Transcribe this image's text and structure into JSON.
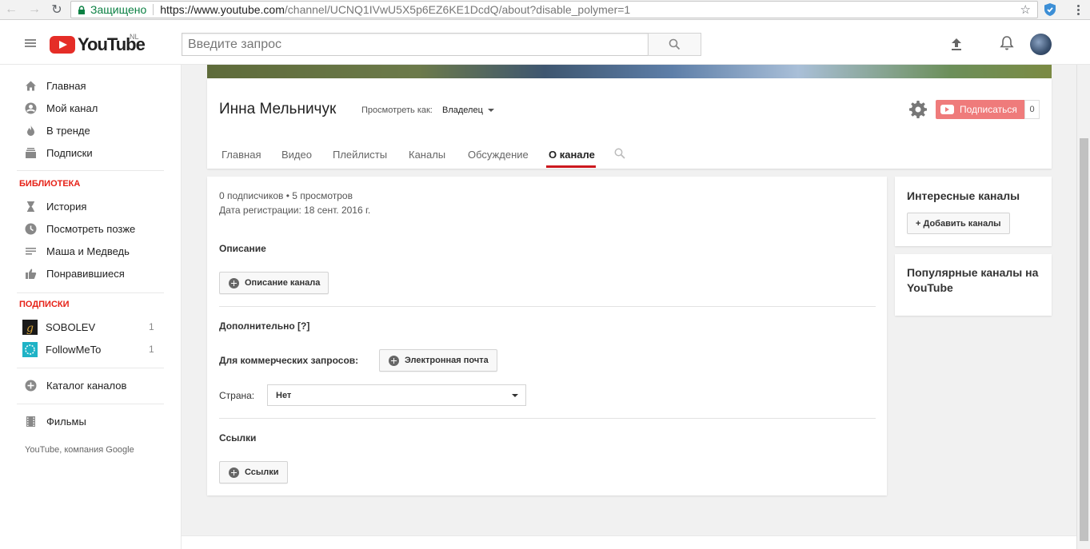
{
  "browser": {
    "secure_label": "Защищено",
    "url_host": "https://www.youtube.com",
    "url_path": "/channel/UCNQ1IVwU5X5p6EZ6KE1DcdQ/about?disable_polymer=1"
  },
  "header": {
    "logo_text": "YouTube",
    "logo_region": "NL",
    "search_placeholder": "Введите запрос"
  },
  "sidebar": {
    "main_items": [
      {
        "label": "Главная",
        "icon": "home-icon"
      },
      {
        "label": "Мой канал",
        "icon": "account-icon"
      },
      {
        "label": "В тренде",
        "icon": "trending-icon"
      },
      {
        "label": "Подписки",
        "icon": "subscriptions-icon"
      }
    ],
    "library_heading": "БИБЛИОТЕКА",
    "library_items": [
      {
        "label": "История",
        "icon": "history-icon"
      },
      {
        "label": "Посмотреть позже",
        "icon": "watch-later-icon"
      },
      {
        "label": "Маша и Медведь",
        "icon": "playlist-icon"
      },
      {
        "label": "Понравившиеся",
        "icon": "thumbs-up-icon"
      }
    ],
    "subscriptions_heading": "ПОДПИСКИ",
    "subscriptions": [
      {
        "label": "SOBOLEV",
        "count": "1"
      },
      {
        "label": "FollowMeTo",
        "count": "1"
      }
    ],
    "catalog_label": "Каталог каналов",
    "movies_label": "Фильмы",
    "footer": "YouTube, компания Google"
  },
  "channel": {
    "name": "Инна Мельничук",
    "view_as_label": "Просмотреть как:",
    "view_as_value": "Владелец",
    "subscribe_label": "Подписаться",
    "subscriber_count": "0",
    "tabs": [
      "Главная",
      "Видео",
      "Плейлисты",
      "Каналы",
      "Обсуждение",
      "О канале"
    ],
    "active_tab": "О канале"
  },
  "about": {
    "stats": "0 подписчиков • 5 просмотров",
    "joined": "Дата регистрации: 18 сент. 2016 г.",
    "description_title": "Описание",
    "description_button": "Описание канала",
    "details_title": "Дополнительно [?]",
    "business_label": "Для коммерческих запросов:",
    "email_button": "Электронная почта",
    "country_label": "Страна:",
    "country_value": "Нет",
    "links_title": "Ссылки",
    "links_button": "Ссылки"
  },
  "right": {
    "featured_title": "Интересные каналы",
    "add_channels_button": "+ Добавить каналы",
    "popular_title": "Популярные каналы на YouTube"
  },
  "colors": {
    "brand_red": "#e52d27",
    "subscribe_bg": "#ef7b7b",
    "tab_underline": "#cc181e",
    "secure_green": "#0b8043"
  }
}
